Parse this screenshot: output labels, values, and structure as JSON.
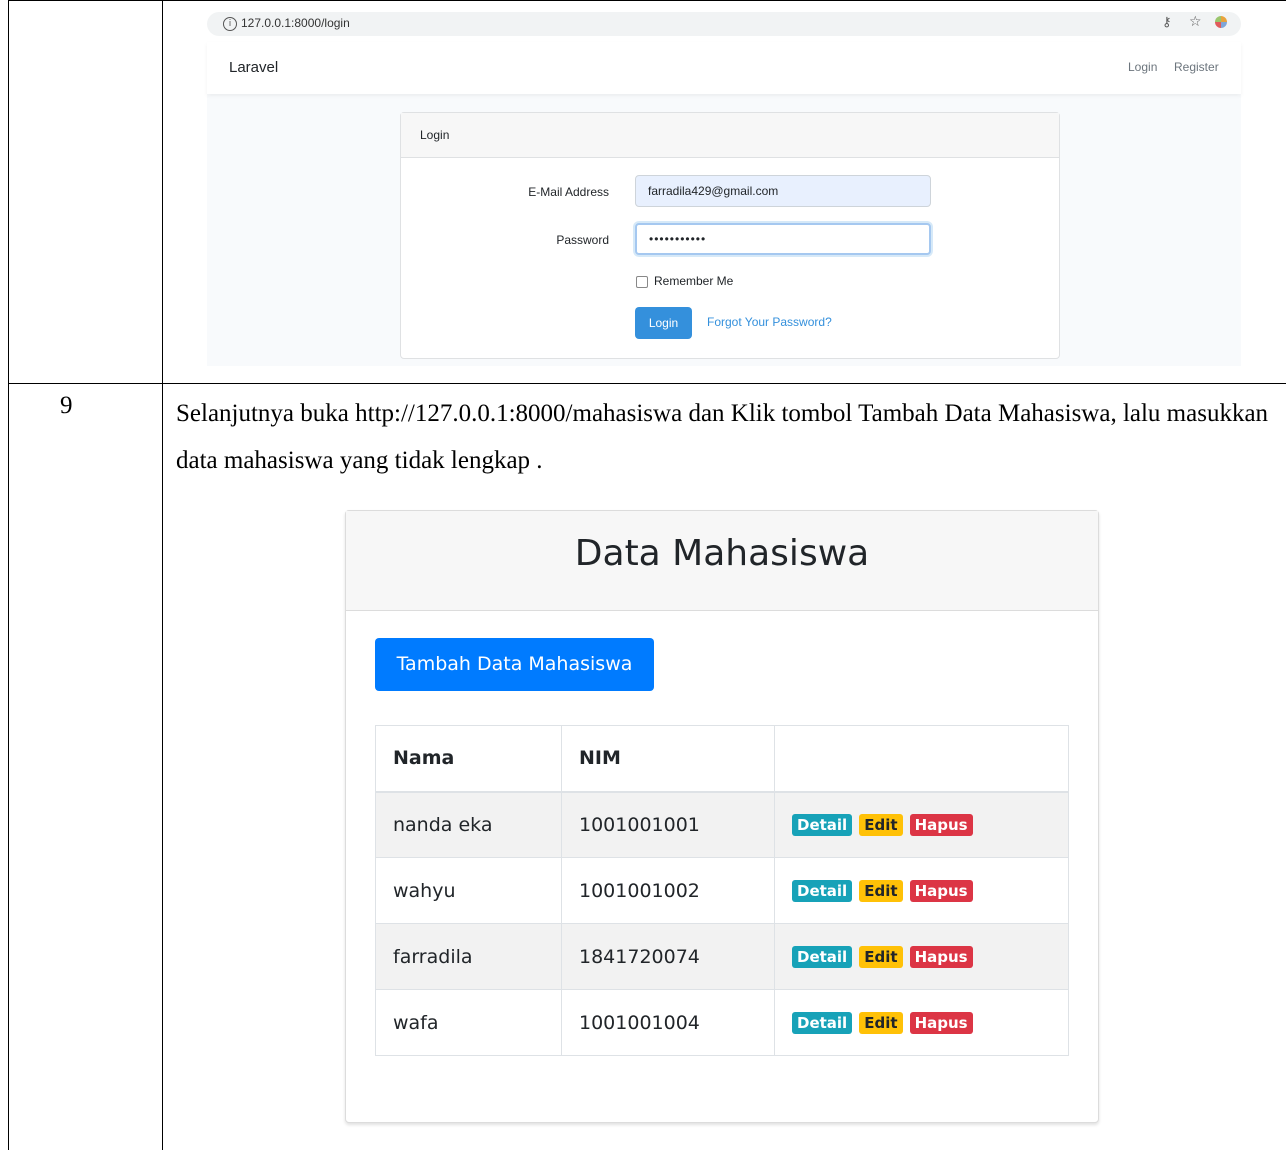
{
  "row_number": "9",
  "instruction": "Selanjutnya buka http://127.0.0.1:8000/mahasiswa dan Klik tombol Tambah Data Mahasiswa, lalu masukkan data mahasiswa yang tidak lengkap .",
  "browser": {
    "url": "127.0.0.1:8000/login",
    "info_glyph": "i",
    "key_glyph": "⚷",
    "star_glyph": "☆",
    "icons": [
      "info-icon",
      "key-icon",
      "star-icon",
      "extension-icon"
    ]
  },
  "navbar": {
    "brand": "Laravel",
    "login": "Login",
    "register": "Register"
  },
  "login_form": {
    "header": "Login",
    "email_label": "E-Mail Address",
    "email_value": "farradila429@gmail.com",
    "password_label": "Password",
    "password_value": "•••••••••••",
    "remember_label": "Remember Me",
    "submit_label": "Login",
    "forgot_label": "Forgot Your Password?"
  },
  "data_mahasiswa": {
    "title": "Data Mahasiswa",
    "add_button": "Tambah Data Mahasiswa",
    "columns": [
      "Nama",
      "NIM",
      ""
    ],
    "rows": [
      {
        "nama": "nanda eka",
        "nim": "1001001001"
      },
      {
        "nama": "wahyu",
        "nim": "1001001002"
      },
      {
        "nama": "farradila",
        "nim": "1841720074"
      },
      {
        "nama": "wafa",
        "nim": "1001001004"
      }
    ],
    "actions": {
      "detail": "Detail",
      "edit": "Edit",
      "hapus": "Hapus"
    }
  },
  "colors": {
    "primary": "#007bff",
    "laravel_blue": "#3490dc",
    "info": "#17a2b8",
    "warning": "#ffc107",
    "danger": "#dc3545"
  }
}
